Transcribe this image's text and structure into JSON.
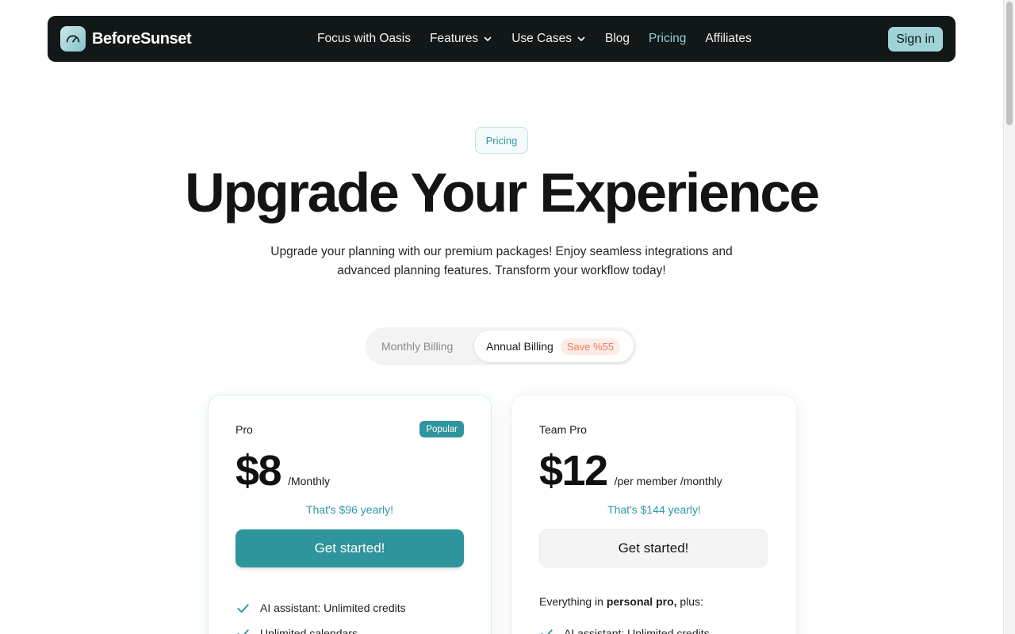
{
  "nav": {
    "brand": "BeforeSunset",
    "links": [
      {
        "label": "Focus with Oasis"
      },
      {
        "label": "Features"
      },
      {
        "label": "Use Cases"
      },
      {
        "label": "Blog"
      },
      {
        "label": "Pricing"
      },
      {
        "label": "Affiliates"
      }
    ],
    "active": "Pricing",
    "signin": "Sign in"
  },
  "hero": {
    "badge": "Pricing",
    "title": "Upgrade Your Experience",
    "subtitle": "Upgrade your planning with our premium packages! Enjoy seamless integrations and advanced planning features. Transform your workflow today!"
  },
  "billing": {
    "monthly": "Monthly Billing",
    "annual": "Annual Billing",
    "save": "Save %55",
    "selected": "Annual Billing"
  },
  "plans": [
    {
      "name": "Pro",
      "badge": "Popular",
      "price": "$8",
      "period": "/Monthly",
      "yearly": "That's $96 yearly!",
      "cta": "Get started!",
      "features": [
        "AI assistant: Unlimited credits",
        "Unlimited calendars"
      ]
    },
    {
      "name": "Team Pro",
      "price": "$12",
      "period": "/per member /monthly",
      "yearly": "That's $144 yearly!",
      "cta": "Get started!",
      "intro_prefix": "Everything in ",
      "intro_bold": "personal pro,",
      "intro_suffix": " plus:",
      "features": [
        "AI assistant: Unlimited credits"
      ]
    }
  ],
  "colors": {
    "accent": "#2f959d",
    "nav_bg": "#121717",
    "save_text": "#ef7b55"
  },
  "icons": {
    "logo": "speedometer-icon",
    "dropdown": "chevron-down-icon",
    "feature": "check-icon"
  }
}
